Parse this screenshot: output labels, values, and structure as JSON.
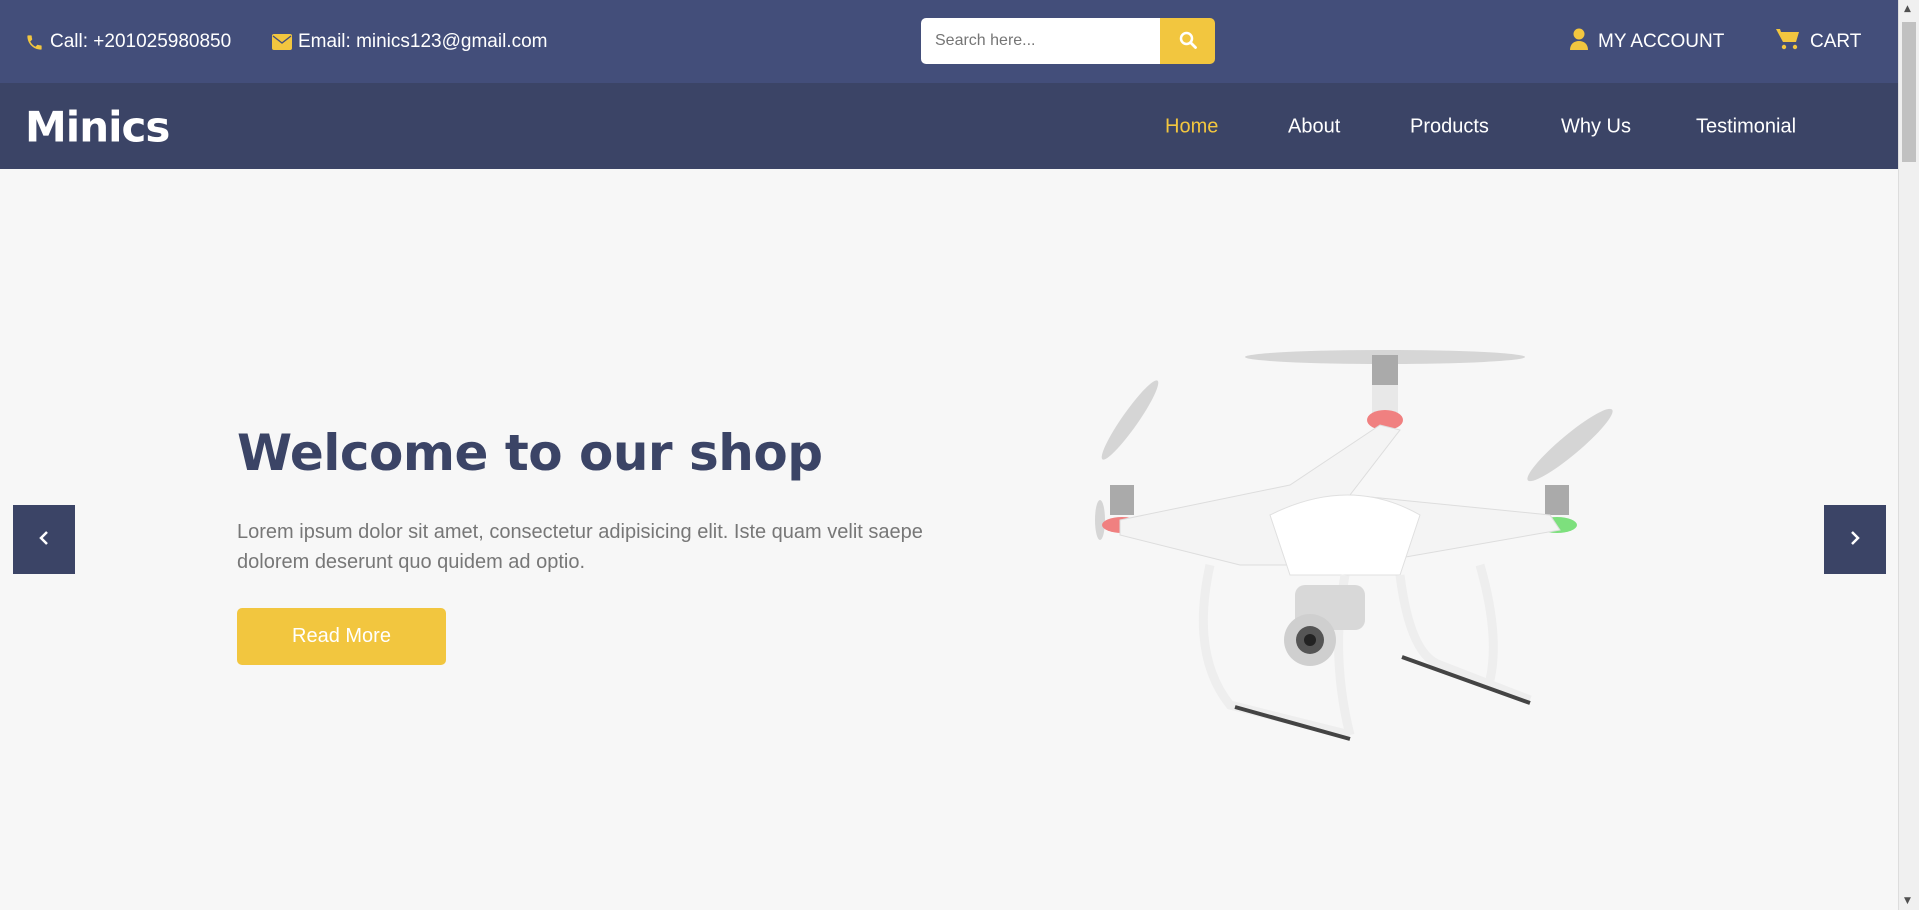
{
  "topbar": {
    "call": "Call: +201025980850",
    "email": "Email: minics123@gmail.com",
    "search_placeholder": "Search here...",
    "my_account": "MY ACCOUNT",
    "cart": "CART"
  },
  "header": {
    "logo": "Minics",
    "nav": [
      {
        "label": "Home",
        "active": true
      },
      {
        "label": "About"
      },
      {
        "label": "Products"
      },
      {
        "label": "Why Us"
      },
      {
        "label": "Testimonial"
      }
    ]
  },
  "hero": {
    "title": "Welcome to our shop",
    "text": "Lorem ipsum dolor sit amet, consectetur adipisicing elit. Iste quam velit saepe dolorem deserunt quo quidem ad optio.",
    "button": "Read More"
  },
  "colors": {
    "accent": "#f2c63f",
    "topbar": "#434e7a",
    "navbar": "#3b4466",
    "background": "#f7f7f7"
  },
  "icons": [
    "phone-icon",
    "envelope-icon",
    "search-icon",
    "user-icon",
    "cart-icon",
    "chevron-left-icon",
    "chevron-right-icon"
  ]
}
